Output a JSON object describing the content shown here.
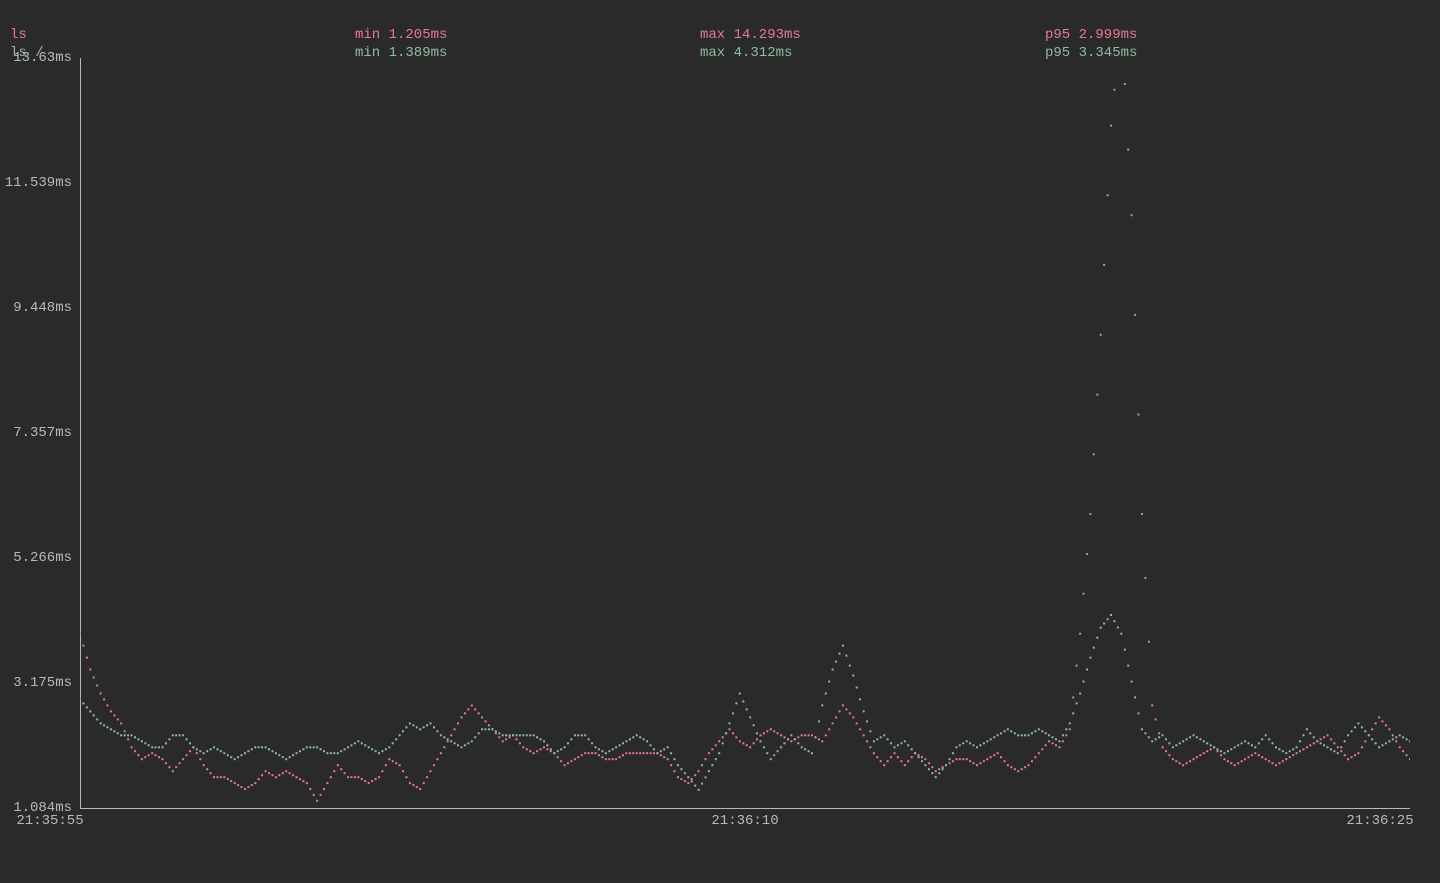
{
  "legend": {
    "rows": [
      {
        "name": "ls",
        "min": "min 1.205ms",
        "max": "max 14.293ms",
        "p95": "p95 2.999ms",
        "color": "pink"
      },
      {
        "name": "ls /",
        "min": "min 1.389ms",
        "max": "max 4.312ms",
        "p95": "p95 3.345ms",
        "color": "green"
      }
    ]
  },
  "chart_data": {
    "type": "line",
    "xlabel": "",
    "ylabel": "",
    "ylim": [
      1.084,
      13.63
    ],
    "y_ticks": [
      "13.63ms",
      "11.539ms",
      "9.448ms",
      "7.357ms",
      "5.266ms",
      "3.175ms",
      "1.084ms"
    ],
    "x_ticks": [
      "21:35:55",
      "21:36:10",
      "21:36:25"
    ],
    "x": [
      0,
      1,
      2,
      3,
      4,
      5,
      6,
      7,
      8,
      9,
      10,
      11,
      12,
      13,
      14,
      15,
      16,
      17,
      18,
      19,
      20,
      21,
      22,
      23,
      24,
      25,
      26,
      27,
      28,
      29,
      30,
      31,
      32,
      33,
      34,
      35,
      36,
      37,
      38,
      39,
      40,
      41,
      42,
      43,
      44,
      45,
      46,
      47,
      48,
      49,
      50,
      51,
      52,
      53,
      54,
      55,
      56,
      57,
      58,
      59,
      60,
      61,
      62,
      63,
      64,
      65,
      66,
      67,
      68,
      69,
      70,
      71,
      72,
      73,
      74,
      75,
      76,
      77,
      78,
      79,
      80,
      81,
      82,
      83,
      84,
      85,
      86,
      87,
      88,
      89,
      90,
      91,
      92,
      93,
      94,
      95,
      96,
      97,
      98,
      99,
      100,
      101,
      102,
      103,
      104,
      105,
      106,
      107,
      108,
      109,
      110,
      111,
      112,
      113,
      114,
      115,
      116,
      117,
      118,
      119,
      120,
      121,
      122,
      123,
      124,
      125,
      126,
      127,
      128,
      129
    ],
    "series": [
      {
        "name": "ls",
        "color": "#e87a90",
        "values": [
          4.0,
          3.4,
          3.0,
          2.7,
          2.5,
          2.1,
          1.9,
          2.0,
          1.9,
          1.7,
          1.9,
          2.1,
          1.8,
          1.6,
          1.6,
          1.5,
          1.4,
          1.5,
          1.7,
          1.6,
          1.7,
          1.6,
          1.5,
          1.205,
          1.5,
          1.8,
          1.6,
          1.6,
          1.5,
          1.6,
          1.9,
          1.8,
          1.5,
          1.4,
          1.7,
          2.0,
          2.3,
          2.6,
          2.8,
          2.6,
          2.4,
          2.2,
          2.3,
          2.1,
          2.0,
          2.1,
          2.0,
          1.8,
          1.9,
          2.0,
          2.0,
          1.9,
          1.9,
          2.0,
          2.0,
          2.0,
          2.0,
          1.9,
          1.6,
          1.5,
          1.7,
          2.0,
          2.2,
          2.4,
          2.2,
          2.1,
          2.3,
          2.4,
          2.3,
          2.2,
          2.3,
          2.3,
          2.2,
          2.5,
          2.8,
          2.6,
          2.3,
          2.0,
          1.8,
          2.0,
          1.8,
          2.0,
          1.9,
          1.7,
          1.8,
          1.9,
          1.9,
          1.8,
          1.9,
          2.0,
          1.8,
          1.7,
          1.8,
          2.0,
          2.2,
          2.1,
          2.4,
          4.0,
          6.0,
          9.0,
          12.5,
          14.293,
          11.0,
          6.0,
          2.8,
          2.1,
          1.9,
          1.8,
          1.9,
          2.0,
          2.1,
          1.9,
          1.8,
          1.9,
          2.0,
          1.9,
          1.8,
          1.9,
          2.0,
          2.1,
          2.2,
          2.3,
          2.1,
          1.9,
          2.0,
          2.3,
          2.6,
          2.4,
          2.1,
          1.9
        ]
      },
      {
        "name": "ls /",
        "color": "#8fbc9f",
        "values": [
          2.9,
          2.7,
          2.5,
          2.4,
          2.3,
          2.3,
          2.2,
          2.1,
          2.1,
          2.3,
          2.3,
          2.1,
          2.0,
          2.1,
          2.0,
          1.9,
          2.0,
          2.1,
          2.1,
          2.0,
          1.9,
          2.0,
          2.1,
          2.1,
          2.0,
          2.0,
          2.1,
          2.2,
          2.1,
          2.0,
          2.1,
          2.3,
          2.5,
          2.4,
          2.5,
          2.3,
          2.2,
          2.1,
          2.2,
          2.4,
          2.4,
          2.3,
          2.3,
          2.3,
          2.3,
          2.2,
          2.0,
          2.1,
          2.3,
          2.3,
          2.1,
          2.0,
          2.1,
          2.2,
          2.3,
          2.2,
          2.0,
          2.1,
          1.8,
          1.6,
          1.389,
          1.7,
          2.0,
          2.5,
          3.0,
          2.6,
          2.2,
          1.9,
          2.1,
          2.3,
          2.1,
          2.0,
          2.8,
          3.4,
          3.8,
          3.3,
          2.7,
          2.2,
          2.3,
          2.1,
          2.2,
          2.0,
          1.8,
          1.6,
          1.8,
          2.1,
          2.2,
          2.1,
          2.2,
          2.3,
          2.4,
          2.3,
          2.3,
          2.4,
          2.3,
          2.2,
          2.5,
          3.0,
          3.6,
          4.1,
          4.312,
          4.0,
          3.2,
          2.4,
          2.2,
          2.3,
          2.1,
          2.2,
          2.3,
          2.2,
          2.1,
          2.0,
          2.1,
          2.2,
          2.1,
          2.3,
          2.1,
          2.0,
          2.1,
          2.4,
          2.2,
          2.1,
          2.0,
          2.3,
          2.5,
          2.3,
          2.1,
          2.2,
          2.3,
          2.2
        ]
      }
    ]
  }
}
